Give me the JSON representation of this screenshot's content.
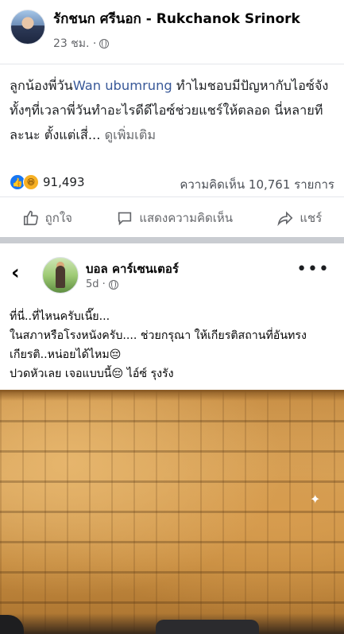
{
  "post": {
    "author": "รักชนก ศรีนอก - Rukchanok Srinork",
    "time": "23 ชม. ·",
    "text_part1": "ลูกน้องพี่วัน",
    "mention": "Wan ubumrung",
    "text_part2": " ทำไมชอบมีปัญหากับไอซ์จัง ทั้งๆที่เวลาพี่วันทำอะไรดีดีไอซ์ช่วยแชร์ให้ตลอด นี่หลายทีละนะ ตั้งแต่เสี่... ",
    "see_more": "ดูเพิ่มเติม",
    "reaction_count": "91,493",
    "comments": "ความคิดเห็น 10,761 รายการ",
    "actions": {
      "like": "ถูกใจ",
      "comment": "แสดงความคิดเห็น",
      "share": "แชร์"
    }
  },
  "shared_post": {
    "author": "บอล คาร์เซนเตอร์",
    "time": "5d ·",
    "lines": [
      "ที่นี่..ที่ไหนครับเนี๊ย...",
      "ในสภาหรือโรงหนังครับ.... ช่วยกรุณา ให้เกียรติสถานที่อันทรงเกียรติ..หน่อยได้ไหม😔",
      "ปวดหัวเลย เจอแบบนี้😔 ไอ์ซ์ รุงรัง"
    ]
  },
  "icons": [
    "globe-icon",
    "like-icon",
    "comment-icon",
    "share-icon",
    "back-arrow-icon",
    "more-icon"
  ],
  "colors": {
    "link": "#385898",
    "like": "#1877f2",
    "muted": "#65676b"
  }
}
